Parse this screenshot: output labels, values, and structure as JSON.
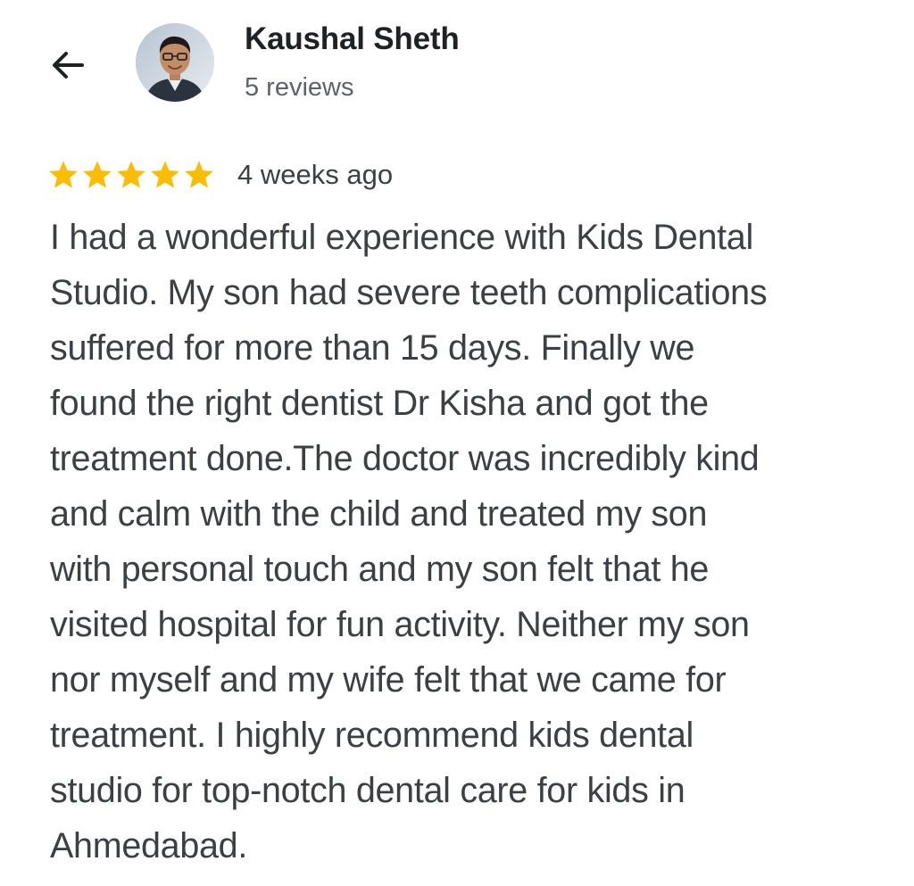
{
  "header": {
    "back_icon": "arrow-left-icon",
    "reviewer_name": "Kaushal Sheth",
    "reviews_count": "5 reviews",
    "avatar": "profile-photo"
  },
  "review": {
    "rating": 5,
    "rating_max": 5,
    "star_color": "#fbbc04",
    "time_ago": "4 weeks ago",
    "text_lines": [
      "I had a wonderful experience with Kids Dental",
      "Studio. My son had severe teeth complications",
      "suffered for more than 15 days. Finally we",
      "found the right dentist Dr Kisha and got the",
      "treatment done.The doctor was incredibly kind",
      "and calm with the child and treated my son",
      "with personal touch and my son felt that he",
      "visited hospital for fun activity. Neither my son",
      "nor  myself and my wife  felt that we came for",
      "treatment. I highly recommend kids dental",
      "studio for top-notch dental care for kids in",
      "Ahmedabad."
    ]
  }
}
